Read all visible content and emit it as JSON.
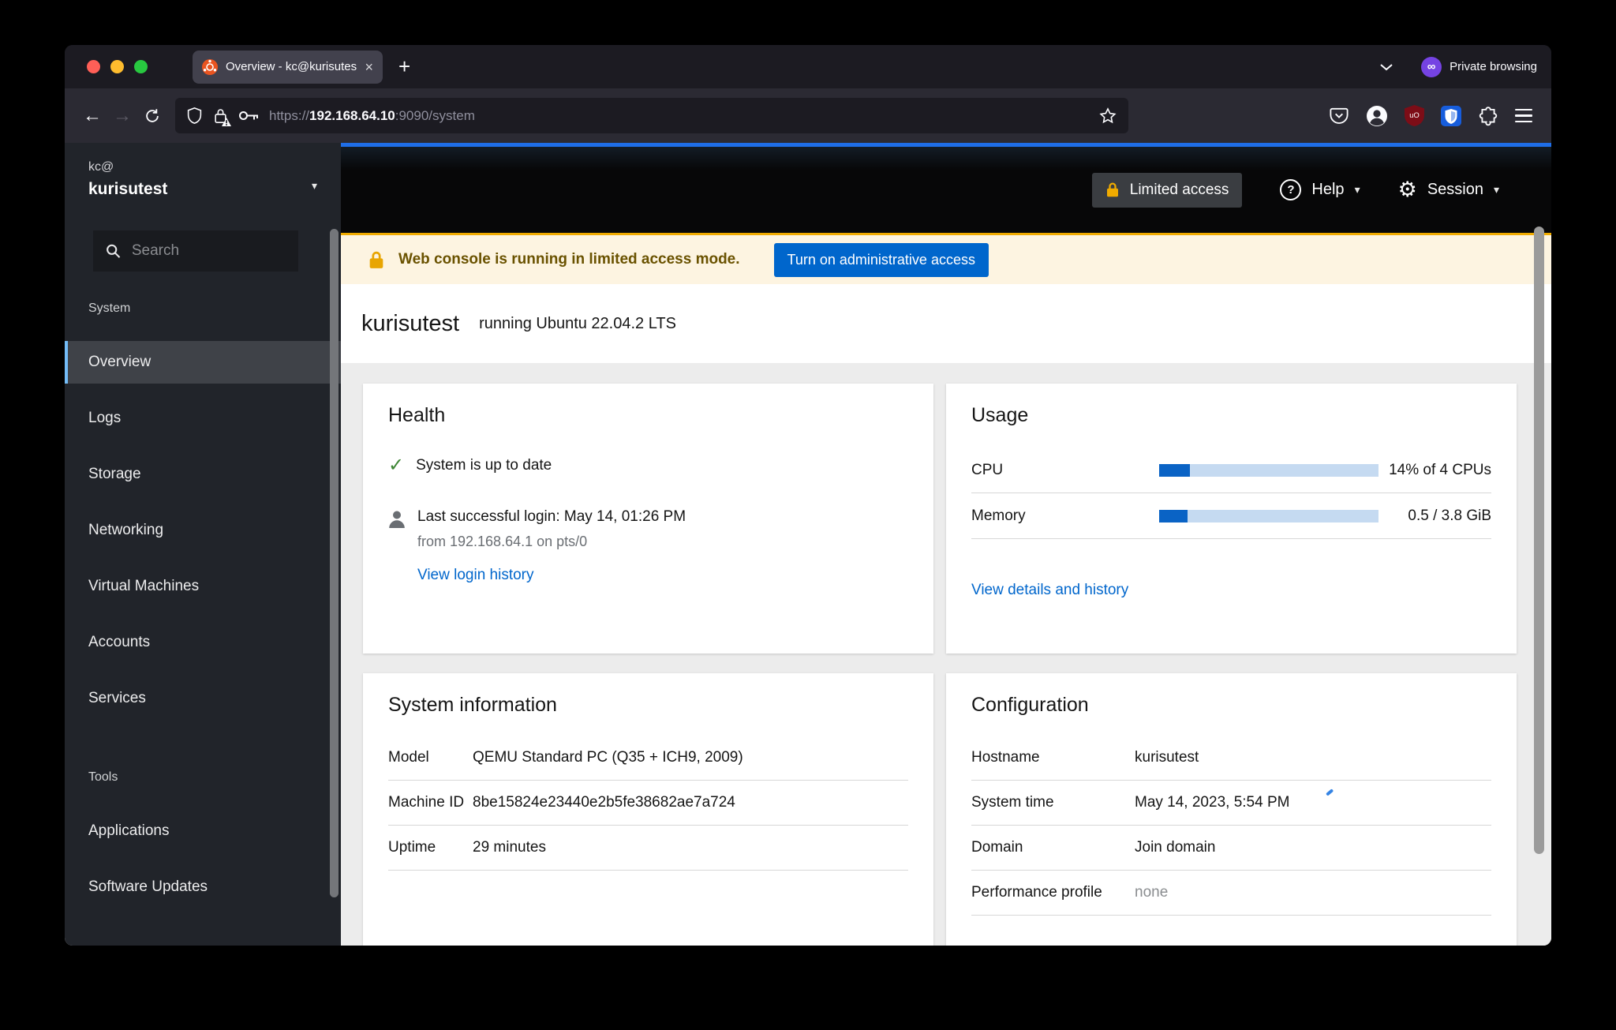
{
  "browser": {
    "tab_title": "Overview - kc@kurisutest",
    "tab_close": "×",
    "new_tab": "+",
    "private_label": "Private browsing",
    "url": {
      "scheme": "https://",
      "host": "192.168.64.10",
      "path": ":9090/system"
    }
  },
  "cockpit": {
    "masthead": {
      "limited_access": "Limited access",
      "help": "Help",
      "session": "Session"
    },
    "banner": {
      "message": "Web console is running in limited access mode.",
      "action": "Turn on administrative access"
    },
    "sidebar": {
      "user": "kc@",
      "host": "kurisutest",
      "search_placeholder": "Search",
      "sections": [
        {
          "label": "System",
          "items": [
            "Overview",
            "Logs",
            "Storage",
            "Networking",
            "Virtual Machines",
            "Accounts",
            "Services"
          ],
          "selected": "Overview"
        },
        {
          "label": "Tools",
          "items": [
            "Applications",
            "Software Updates"
          ]
        }
      ]
    },
    "page_header": {
      "hostname": "kurisutest",
      "os": "running Ubuntu 22.04.2 LTS"
    },
    "cards": {
      "health": {
        "title": "Health",
        "up_to_date": "System is up to date",
        "last_login": "Last successful login: May 14, 01:26 PM",
        "last_login_from": "from 192.168.64.1 on pts/0",
        "view_login_history": "View login history"
      },
      "usage": {
        "title": "Usage",
        "rows": [
          {
            "label": "CPU",
            "value": "14% of 4 CPUs",
            "percent": 14
          },
          {
            "label": "Memory",
            "value": "0.5 / 3.8 GiB",
            "percent": 13
          }
        ],
        "link": "View details and history"
      },
      "system_information": {
        "title": "System information",
        "rows": [
          {
            "label": "Model",
            "value": "QEMU Standard PC (Q35 + ICH9, 2009)"
          },
          {
            "label": "Machine ID",
            "value": "8be15824e23440e2b5fe38682ae7a724"
          },
          {
            "label": "Uptime",
            "value": "29 minutes"
          }
        ]
      },
      "configuration": {
        "title": "Configuration",
        "rows": [
          {
            "label": "Hostname",
            "value": "kurisutest"
          },
          {
            "label": "System time",
            "value": "May 14, 2023, 5:54 PM"
          },
          {
            "label": "Domain",
            "value": "Join domain"
          },
          {
            "label": "Performance profile",
            "value": "none"
          }
        ]
      }
    }
  },
  "icons": {
    "private_mask": "∞",
    "gear": "⚙",
    "caret_down": "▾",
    "check": "✓",
    "back_arrow": "←",
    "forward_arrow": "→"
  },
  "colors": {
    "accent_blue": "#1f6ee8",
    "action_blue": "#0066cc",
    "link_blue": "#0066cc",
    "progress_fill": "#0a63c5",
    "progress_track": "#c5daf1",
    "warning_gold": "#f0ab00",
    "banner_bg": "#fdf4e1",
    "banner_text": "#6a5200",
    "success_green": "#3e8635",
    "private_purple": "#7543e3",
    "ubuntu_orange": "#e95420",
    "sidebar_bg": "#21242a",
    "selected_item_bg": "#3f4248",
    "selected_item_border": "#73bcf7",
    "masthead_bg": "#070708",
    "content_bg": "#ececec",
    "traffic_red": "#ff5f57",
    "traffic_yellow": "#febc2e",
    "traffic_green": "#28c840"
  }
}
